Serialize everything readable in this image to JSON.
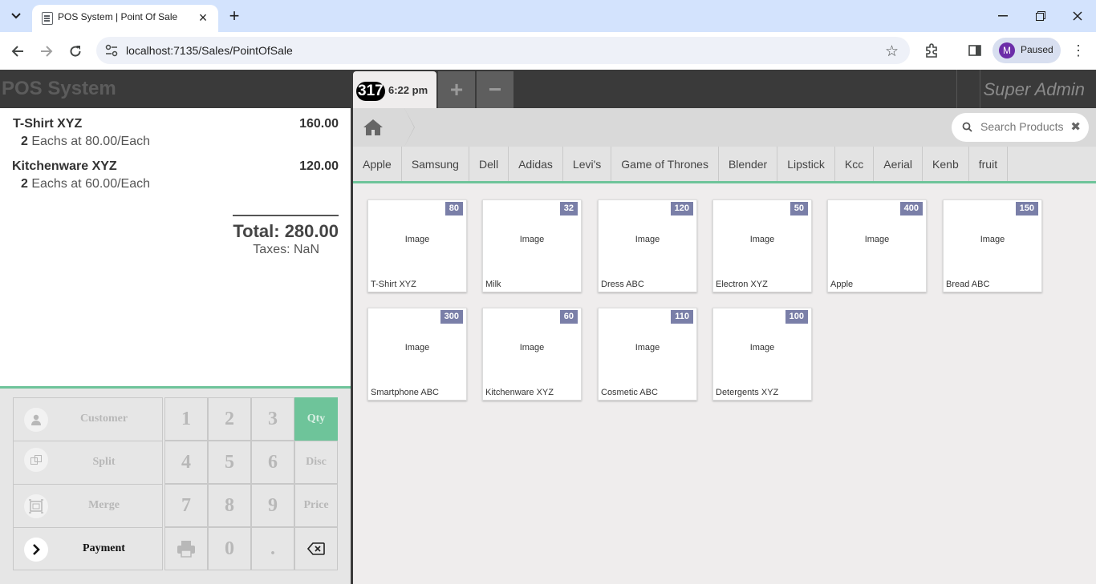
{
  "browser": {
    "tab_title": "POS System | Point Of Sale",
    "url": "localhost:7135/Sales/PointOfSale",
    "profile_initial": "M",
    "profile_status": "Paused"
  },
  "app": {
    "brand": "POS System",
    "user": "Super Admin",
    "order_number": "317",
    "order_time": "6:22 pm",
    "add_order": "+",
    "remove_order": "−"
  },
  "order": {
    "lines": [
      {
        "name": "T-Shirt XYZ",
        "price": "160.00",
        "qty": "2",
        "unit_info": "Eachs at 80.00/Each"
      },
      {
        "name": "Kitchenware XYZ",
        "price": "120.00",
        "qty": "2",
        "unit_info": "Eachs at 60.00/Each"
      }
    ],
    "total": "Total: 280.00",
    "taxes": "Taxes: NaN"
  },
  "controls": {
    "customer": "Customer",
    "split": "Split",
    "merge": "Merge",
    "payment": "Payment"
  },
  "numpad": {
    "k1": "1",
    "k2": "2",
    "k3": "3",
    "qty": "Qty",
    "k4": "4",
    "k5": "5",
    "k6": "6",
    "disc": "Disc",
    "k7": "7",
    "k8": "8",
    "k9": "9",
    "price": "Price",
    "k0": "0",
    "dot": "."
  },
  "search": {
    "placeholder": "Search Products",
    "clear": "✖"
  },
  "categories": [
    "Apple",
    "Samsung",
    "Dell",
    "Adidas",
    "Levi's",
    "Game of Thrones",
    "Blender",
    "Lipstick",
    "Kcc",
    "Aerial",
    "Kenb",
    "fruit"
  ],
  "products": [
    {
      "name": "T-Shirt XYZ",
      "price": "80",
      "image": "Image"
    },
    {
      "name": "Milk",
      "price": "32",
      "image": "Image"
    },
    {
      "name": "Dress ABC",
      "price": "120",
      "image": "Image"
    },
    {
      "name": "Electron XYZ",
      "price": "50",
      "image": "Image"
    },
    {
      "name": "Apple",
      "price": "400",
      "image": "Image"
    },
    {
      "name": "Bread ABC",
      "price": "150",
      "image": "Image"
    },
    {
      "name": "Smartphone ABC",
      "price": "300",
      "image": "Image"
    },
    {
      "name": "Kitchenware XYZ",
      "price": "60",
      "image": "Image"
    },
    {
      "name": "Cosmetic ABC",
      "price": "110",
      "image": "Image"
    },
    {
      "name": "Detergents XYZ",
      "price": "100",
      "image": "Image"
    }
  ],
  "colors": {
    "accent": "#6ec49a",
    "header": "#3a3a3a",
    "price_badge": "#7a7fa8"
  }
}
